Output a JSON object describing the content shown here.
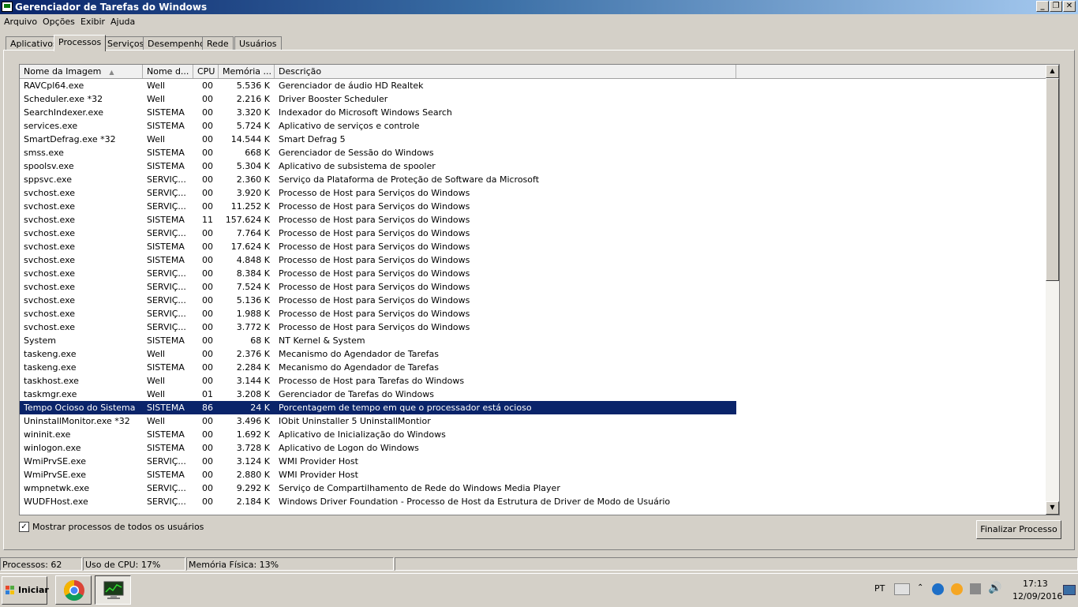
{
  "window": {
    "title": "Gerenciador de Tarefas do Windows",
    "controls": {
      "minimize": "_",
      "restore": "❐",
      "close": "✕"
    }
  },
  "menu": [
    "Arquivo",
    "Opções",
    "Exibir",
    "Ajuda"
  ],
  "tabs": [
    "Aplicativos",
    "Processos",
    "Serviços",
    "Desempenho",
    "Rede",
    "Usuários"
  ],
  "active_tab": "Processos",
  "table": {
    "columns": [
      "Nome da Imagem",
      "Nome d...",
      "CPU",
      "Memória ...",
      "Descrição"
    ],
    "sort_icon": "sort-ascending-icon",
    "rows": [
      [
        "RAVCpl64.exe",
        "Well",
        "00",
        "5.536 K",
        "Gerenciador de áudio HD Realtek"
      ],
      [
        "Scheduler.exe *32",
        "Well",
        "00",
        "2.216 K",
        "Driver Booster Scheduler"
      ],
      [
        "SearchIndexer.exe",
        "SISTEMA",
        "00",
        "3.320 K",
        "Indexador do Microsoft Windows Search"
      ],
      [
        "services.exe",
        "SISTEMA",
        "00",
        "5.724 K",
        "Aplicativo de serviços e controle"
      ],
      [
        "SmartDefrag.exe *32",
        "Well",
        "00",
        "14.544 K",
        "Smart Defrag 5"
      ],
      [
        "smss.exe",
        "SISTEMA",
        "00",
        "668 K",
        "Gerenciador de Sessão do Windows"
      ],
      [
        "spoolsv.exe",
        "SISTEMA",
        "00",
        "5.304 K",
        "Aplicativo de subsistema de spooler"
      ],
      [
        "sppsvc.exe",
        "SERVIÇ...",
        "00",
        "2.360 K",
        "Serviço da Plataforma de Proteção de Software da Microsoft"
      ],
      [
        "svchost.exe",
        "SERVIÇ...",
        "00",
        "3.920 K",
        "Processo de Host para Serviços do Windows"
      ],
      [
        "svchost.exe",
        "SERVIÇ...",
        "00",
        "11.252 K",
        "Processo de Host para Serviços do Windows"
      ],
      [
        "svchost.exe",
        "SISTEMA",
        "11",
        "157.624 K",
        "Processo de Host para Serviços do Windows"
      ],
      [
        "svchost.exe",
        "SERVIÇ...",
        "00",
        "7.764 K",
        "Processo de Host para Serviços do Windows"
      ],
      [
        "svchost.exe",
        "SISTEMA",
        "00",
        "17.624 K",
        "Processo de Host para Serviços do Windows"
      ],
      [
        "svchost.exe",
        "SISTEMA",
        "00",
        "4.848 K",
        "Processo de Host para Serviços do Windows"
      ],
      [
        "svchost.exe",
        "SERVIÇ...",
        "00",
        "8.384 K",
        "Processo de Host para Serviços do Windows"
      ],
      [
        "svchost.exe",
        "SERVIÇ...",
        "00",
        "7.524 K",
        "Processo de Host para Serviços do Windows"
      ],
      [
        "svchost.exe",
        "SERVIÇ...",
        "00",
        "5.136 K",
        "Processo de Host para Serviços do Windows"
      ],
      [
        "svchost.exe",
        "SERVIÇ...",
        "00",
        "1.988 K",
        "Processo de Host para Serviços do Windows"
      ],
      [
        "svchost.exe",
        "SERVIÇ...",
        "00",
        "3.772 K",
        "Processo de Host para Serviços do Windows"
      ],
      [
        "System",
        "SISTEMA",
        "00",
        "68 K",
        "NT Kernel & System"
      ],
      [
        "taskeng.exe",
        "Well",
        "00",
        "2.376 K",
        "Mecanismo do Agendador de Tarefas"
      ],
      [
        "taskeng.exe",
        "SISTEMA",
        "00",
        "2.284 K",
        "Mecanismo do Agendador de Tarefas"
      ],
      [
        "taskhost.exe",
        "Well",
        "00",
        "3.144 K",
        "Processo de Host para Tarefas do Windows"
      ],
      [
        "taskmgr.exe",
        "Well",
        "01",
        "3.208 K",
        "Gerenciador de Tarefas do Windows"
      ],
      [
        "Tempo Ocioso do Sistema",
        "SISTEMA",
        "86",
        "24 K",
        "Porcentagem de tempo em que o processador está ocioso"
      ],
      [
        "UninstallMonitor.exe *32",
        "Well",
        "00",
        "3.496 K",
        "IObit Uninstaller 5 UninstallMontior"
      ],
      [
        "wininit.exe",
        "SISTEMA",
        "00",
        "1.692 K",
        "Aplicativo de Inicialização do Windows"
      ],
      [
        "winlogon.exe",
        "SISTEMA",
        "00",
        "3.728 K",
        "Aplicativo de Logon do Windows"
      ],
      [
        "WmiPrvSE.exe",
        "SERVIÇ...",
        "00",
        "3.124 K",
        "WMI Provider Host"
      ],
      [
        "WmiPrvSE.exe",
        "SISTEMA",
        "00",
        "2.880 K",
        "WMI Provider Host"
      ],
      [
        "wmpnetwk.exe",
        "SERVIÇ...",
        "00",
        "9.292 K",
        "Serviço de Compartilhamento de Rede do Windows Media Player"
      ],
      [
        "WUDFHost.exe",
        "SERVIÇ...",
        "00",
        "2.184 K",
        "Windows Driver Foundation - Processo de Host da Estrutura de Driver de Modo de Usuário"
      ]
    ],
    "selected_row": 24
  },
  "show_all_users": {
    "label": "Mostrar processos de todos os usuários",
    "checked": true,
    "mark": "✓"
  },
  "end_process_button": "Finalizar Processo",
  "status": {
    "processes": "Processos: 62",
    "cpu": "Uso de CPU: 17%",
    "memory": "Memória Física: 13%"
  },
  "taskbar": {
    "start_label": "Iniciar",
    "apps": [
      "chrome-icon",
      "task-manager-icon"
    ],
    "language": "PT",
    "time": "17:13",
    "date": "12/09/2016"
  },
  "colors": {
    "selection": "#0a246a",
    "title_start": "#0a246a",
    "title_end": "#a6caf0",
    "face": "#d4d0c8"
  }
}
